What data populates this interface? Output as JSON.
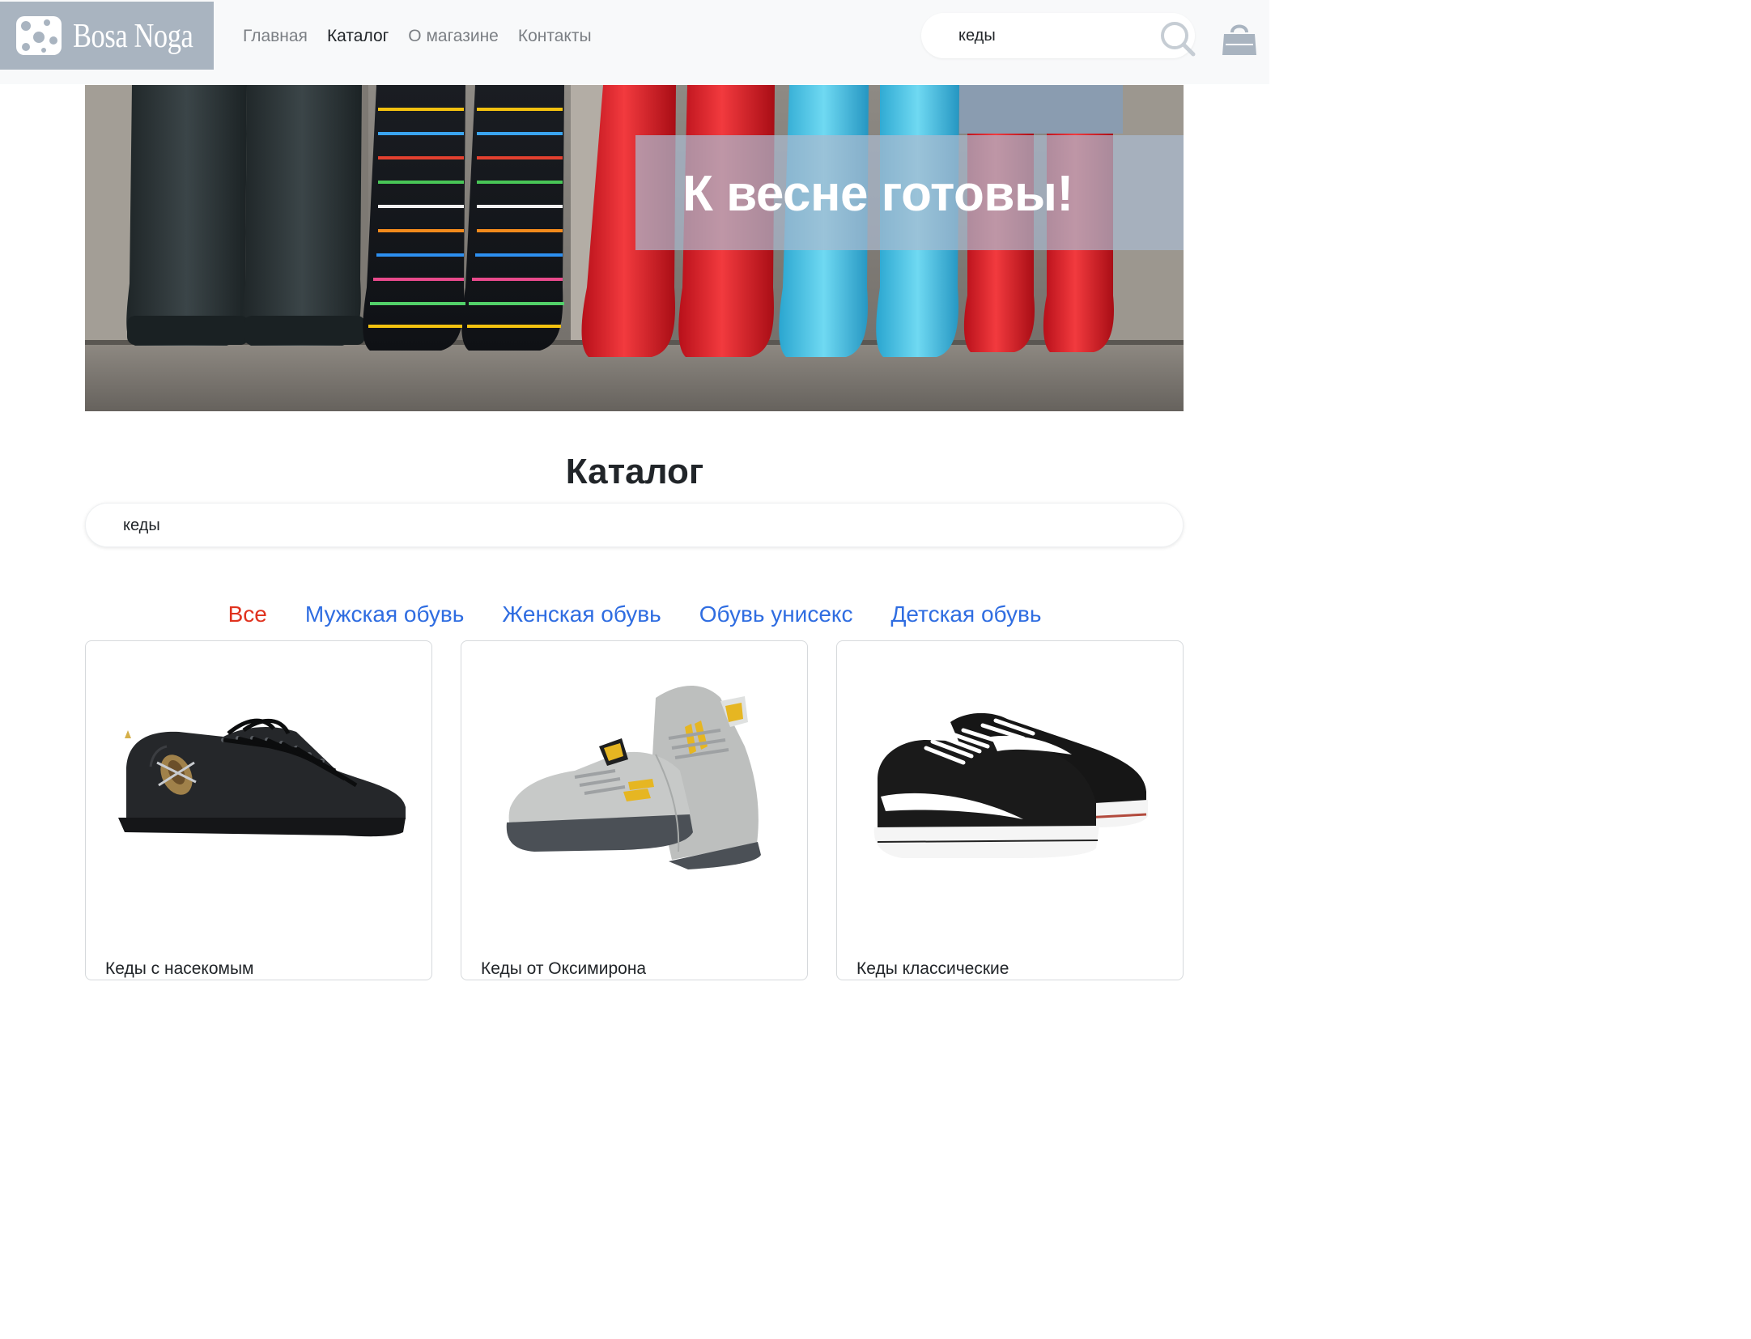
{
  "header": {
    "logo_text": "Bosa Noga",
    "nav": [
      {
        "label": "Главная",
        "active": false
      },
      {
        "label": "Каталог",
        "active": true
      },
      {
        "label": "О магазине",
        "active": false
      },
      {
        "label": "Контакты",
        "active": false
      }
    ],
    "search_value": "кеды",
    "icons": [
      "search-icon",
      "shopping-bag-icon"
    ]
  },
  "banner": {
    "headline": "К весне готовы!"
  },
  "catalog": {
    "title": "Каталог",
    "search_value": "кеды",
    "categories": [
      {
        "label": "Все",
        "active": true
      },
      {
        "label": "Мужская обувь",
        "active": false
      },
      {
        "label": "Женская обувь",
        "active": false
      },
      {
        "label": "Обувь унисекс",
        "active": false
      },
      {
        "label": "Детская обувь",
        "active": false
      }
    ],
    "products": [
      {
        "title": "Кеды с насекомым"
      },
      {
        "title": "Кеды от Оксимирона"
      },
      {
        "title": "Кеды классические"
      }
    ]
  },
  "colors": {
    "header_bg": "#f8f9fa",
    "logo_bg": "#a9b4c0",
    "category_link": "#2f6de1",
    "category_active": "#e0321e"
  }
}
